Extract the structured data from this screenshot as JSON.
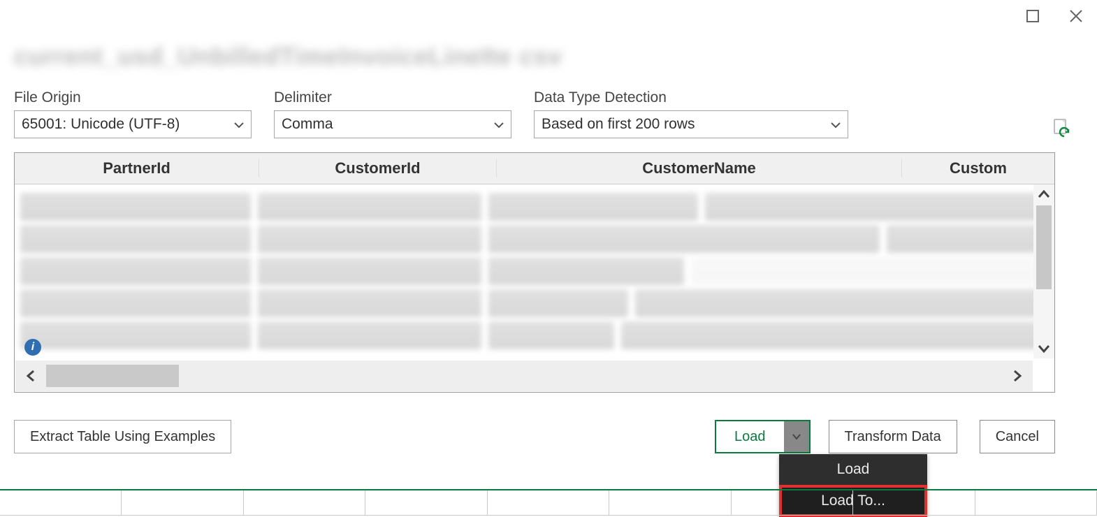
{
  "window": {
    "filename_blurred": "current_usd_UnbilledTimeInvoiceLineIte csv"
  },
  "fields": {
    "file_origin": {
      "label": "File Origin",
      "value": "65001: Unicode (UTF-8)"
    },
    "delimiter": {
      "label": "Delimiter",
      "value": "Comma"
    },
    "detection": {
      "label": "Data Type Detection",
      "value": "Based on first 200 rows"
    }
  },
  "columns": {
    "c1": "PartnerId",
    "c2": "CustomerId",
    "c3": "CustomerName",
    "c4": "Custom"
  },
  "buttons": {
    "extract": "Extract Table Using Examples",
    "load": "Load",
    "transform": "Transform Data",
    "cancel": "Cancel"
  },
  "load_menu": {
    "item1": "Load",
    "item2": "Load To..."
  }
}
